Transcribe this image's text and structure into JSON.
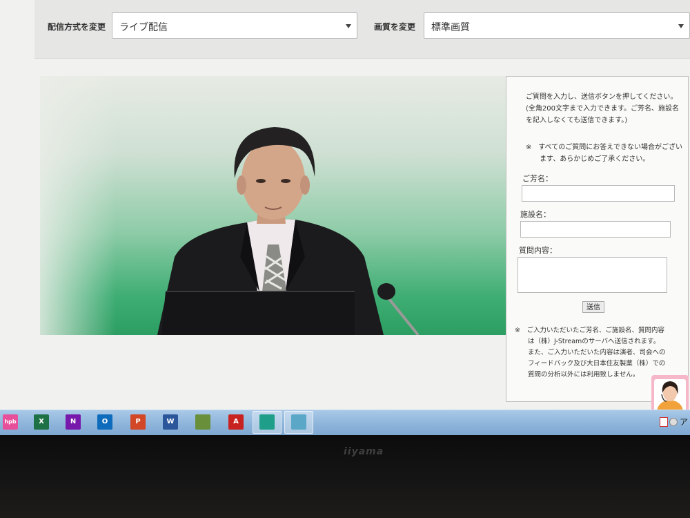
{
  "controls": {
    "delivery_label": "配信方式を変更",
    "delivery_value": "ライブ配信",
    "quality_label": "画質を変更",
    "quality_value": "標準画質"
  },
  "form": {
    "intro_lines": [
      "ご質問を入力し、送信ボタンを押してください。",
      "(全角200文字まで入力できます。ご芳名、施設名",
      "を記入しなくても送信できます。)"
    ],
    "notice_lines": [
      "※　すべてのご質問にお答えできない場合がござい",
      "　　ます、あらかじめご了承ください。"
    ],
    "name_label": "ご芳名：",
    "facility_label": "施設名：",
    "question_label": "質問内容：",
    "submit_label": "送信",
    "footer_lines": [
      "※　ご入力いただいたご芳名、ご施設名、質問内容",
      "　　は（株）J-Streamのサーバへ送信されます。",
      "　　また、ご入力いただいた内容は演者、司会への",
      "　　フィードバック及び大日本住友製薬（株）での",
      "　　質問の分析以外には利用致しません。"
    ]
  },
  "taskbar": {
    "apps": [
      {
        "name": "hpb",
        "glyph": "hpb",
        "color": "#e84f9a"
      },
      {
        "name": "excel-icon",
        "glyph": "X",
        "color": "#1e7145"
      },
      {
        "name": "onenote-icon",
        "glyph": "N",
        "color": "#7719aa"
      },
      {
        "name": "outlook-icon",
        "glyph": "O",
        "color": "#0f6cbd"
      },
      {
        "name": "powerpoint-icon",
        "glyph": "P",
        "color": "#d24726"
      },
      {
        "name": "word-icon",
        "glyph": "W",
        "color": "#2b579a"
      },
      {
        "name": "pdf-editor-icon",
        "glyph": "",
        "color": "#6a8f3a"
      },
      {
        "name": "acrobat-icon",
        "glyph": "A",
        "color": "#c7221f"
      },
      {
        "name": "shield-app-icon",
        "glyph": "",
        "color": "#1f9e8a"
      },
      {
        "name": "notepad-icon",
        "glyph": "",
        "color": "#5aa7c8"
      }
    ],
    "tray_text": "ア"
  },
  "monitor": {
    "brand": "iiyama"
  }
}
